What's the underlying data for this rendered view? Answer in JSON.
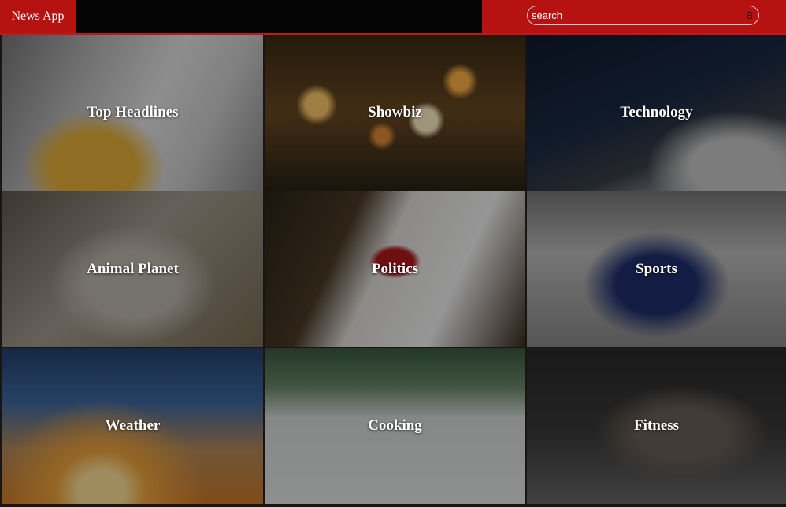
{
  "header": {
    "brand": "News App",
    "search": {
      "placeholder": "search",
      "button_label": "B"
    }
  },
  "colors": {
    "brand_red": "#b71212",
    "topbar_bg": "#050505"
  },
  "categories": [
    {
      "label": "Top Headlines"
    },
    {
      "label": "Showbiz"
    },
    {
      "label": "Technology"
    },
    {
      "label": "Animal Planet"
    },
    {
      "label": "Politics"
    },
    {
      "label": "Sports"
    },
    {
      "label": "Weather"
    },
    {
      "label": "Cooking"
    },
    {
      "label": "Fitness"
    }
  ]
}
